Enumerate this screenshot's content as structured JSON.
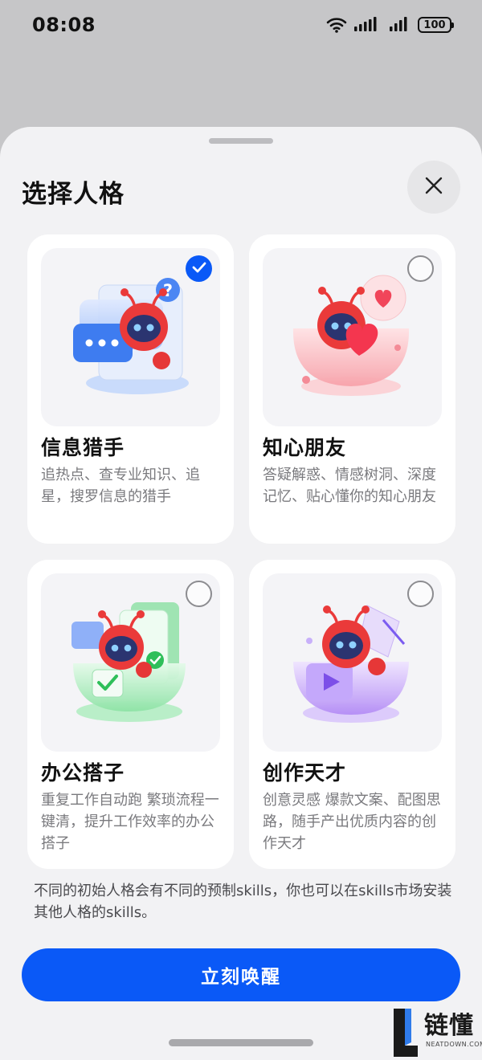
{
  "status_bar": {
    "time": "08:08",
    "battery": "100",
    "icons": [
      "wifi-icon",
      "signal-icon",
      "signal-icon",
      "battery-icon"
    ]
  },
  "sheet": {
    "title": "选择人格",
    "close_icon": "close-icon"
  },
  "personas": [
    {
      "name": "信息猎手",
      "description": "追热点、查专业知识、追星，搜罗信息的猎手",
      "selected": true,
      "accent": "#3b82f6"
    },
    {
      "name": "知心朋友",
      "description": "答疑解惑、情感树洞、深度记忆、贴心懂你的知心朋友",
      "selected": false,
      "accent": "#f26b7a"
    },
    {
      "name": "办公搭子",
      "description": "重复工作自动跑 繁琐流程一键清，提升工作效率的办公搭子",
      "selected": false,
      "accent": "#3fcf6e"
    },
    {
      "name": "创作天才",
      "description": "创意灵感 爆款文案、配图思路，随手产出优质内容的创作天才",
      "selected": false,
      "accent": "#9b6bf2"
    }
  ],
  "note": "不同的初始人格会有不同的预制skills，你也可以在skills市场安装其他人格的skills。",
  "primary_button": {
    "label": "立刻唤醒"
  },
  "watermark": {
    "text": "链懂",
    "sub": "NEATDOWN.COM"
  },
  "colors": {
    "accent": "#0a59f7",
    "sheet_bg": "#f2f2f4",
    "scrim": "#c6c6c8"
  }
}
